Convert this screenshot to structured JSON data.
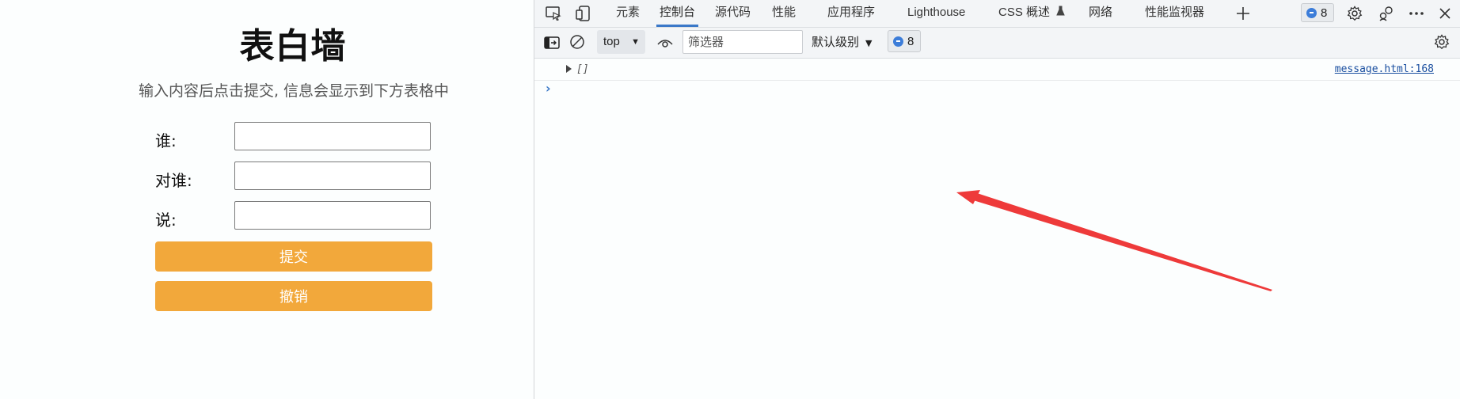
{
  "page": {
    "title": "表白墙",
    "subtitle": "输入内容后点击提交, 信息会显示到下方表格中",
    "fields": [
      {
        "label": "谁:",
        "value": ""
      },
      {
        "label": "对谁:",
        "value": ""
      },
      {
        "label": "说:",
        "value": ""
      }
    ],
    "submit_label": "提交",
    "undo_label": "撤销"
  },
  "devtools": {
    "tabs": [
      {
        "label": "元素"
      },
      {
        "label": "控制台",
        "active": true
      },
      {
        "label": "源代码"
      },
      {
        "label": "性能"
      },
      {
        "label": "应用程序"
      },
      {
        "label": "Lighthouse"
      },
      {
        "label": "CSS 概述"
      },
      {
        "label": "网络"
      },
      {
        "label": "性能监视器"
      }
    ],
    "message_count": "8",
    "toolbar": {
      "context": "top",
      "filter_placeholder": "筛选器",
      "level": "默认级别",
      "issue_count": "8"
    },
    "console": {
      "entries": [
        {
          "value": "[]",
          "source": "message.html:168"
        }
      ],
      "prompt": "›"
    }
  },
  "colors": {
    "button": "#f2a83b",
    "accent": "#3a78c8",
    "arrow": "#ee3a3a"
  },
  "icons": [
    "inspect-icon",
    "device-toolbar-icon",
    "beaker-icon",
    "plus-icon",
    "message-icon",
    "gear-icon",
    "connections-icon",
    "more-icon",
    "close-icon",
    "drawer-toggle-icon",
    "clear-console-icon",
    "eye-icon"
  ]
}
